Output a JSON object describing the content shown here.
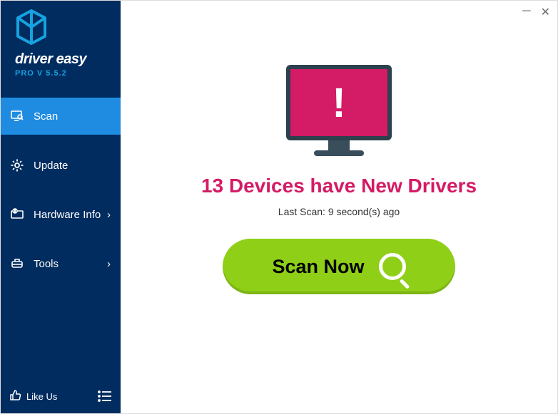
{
  "brand": {
    "name": "driver easy",
    "version": "PRO V 5.5.2"
  },
  "sidebar": {
    "items": [
      {
        "label": "Scan",
        "chevron": ""
      },
      {
        "label": "Update",
        "chevron": ""
      },
      {
        "label": "Hardware Info",
        "chevron": "›"
      },
      {
        "label": "Tools",
        "chevron": "›"
      }
    ],
    "like": "Like Us"
  },
  "main": {
    "headline": "13 Devices have New Drivers",
    "subline": "Last Scan: 9 second(s) ago",
    "scan_label": "Scan Now"
  },
  "winctrl": {
    "min": "─",
    "close": "✕"
  }
}
